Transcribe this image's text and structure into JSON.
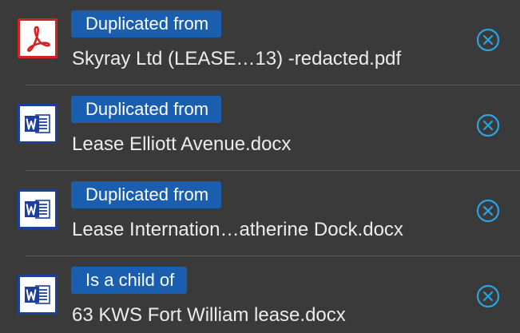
{
  "relations": [
    {
      "badge": "Duplicated from",
      "filename": "Skyray Ltd (LEASE…13) -redacted.pdf",
      "icon": "pdf-icon"
    },
    {
      "badge": "Duplicated from",
      "filename": "Lease Elliott Avenue.docx",
      "icon": "word-icon"
    },
    {
      "badge": "Duplicated from",
      "filename": "Lease Internation…atherine Dock.docx",
      "icon": "word-icon"
    },
    {
      "badge": "Is a child of",
      "filename": "63 KWS Fort William lease.docx",
      "icon": "word-icon"
    }
  ],
  "colors": {
    "background": "#3a3a3a",
    "badge": "#1a5faf",
    "remove_icon": "#2aa3e0",
    "pdf_red": "#d32222",
    "word_blue": "#1d3f9c"
  }
}
